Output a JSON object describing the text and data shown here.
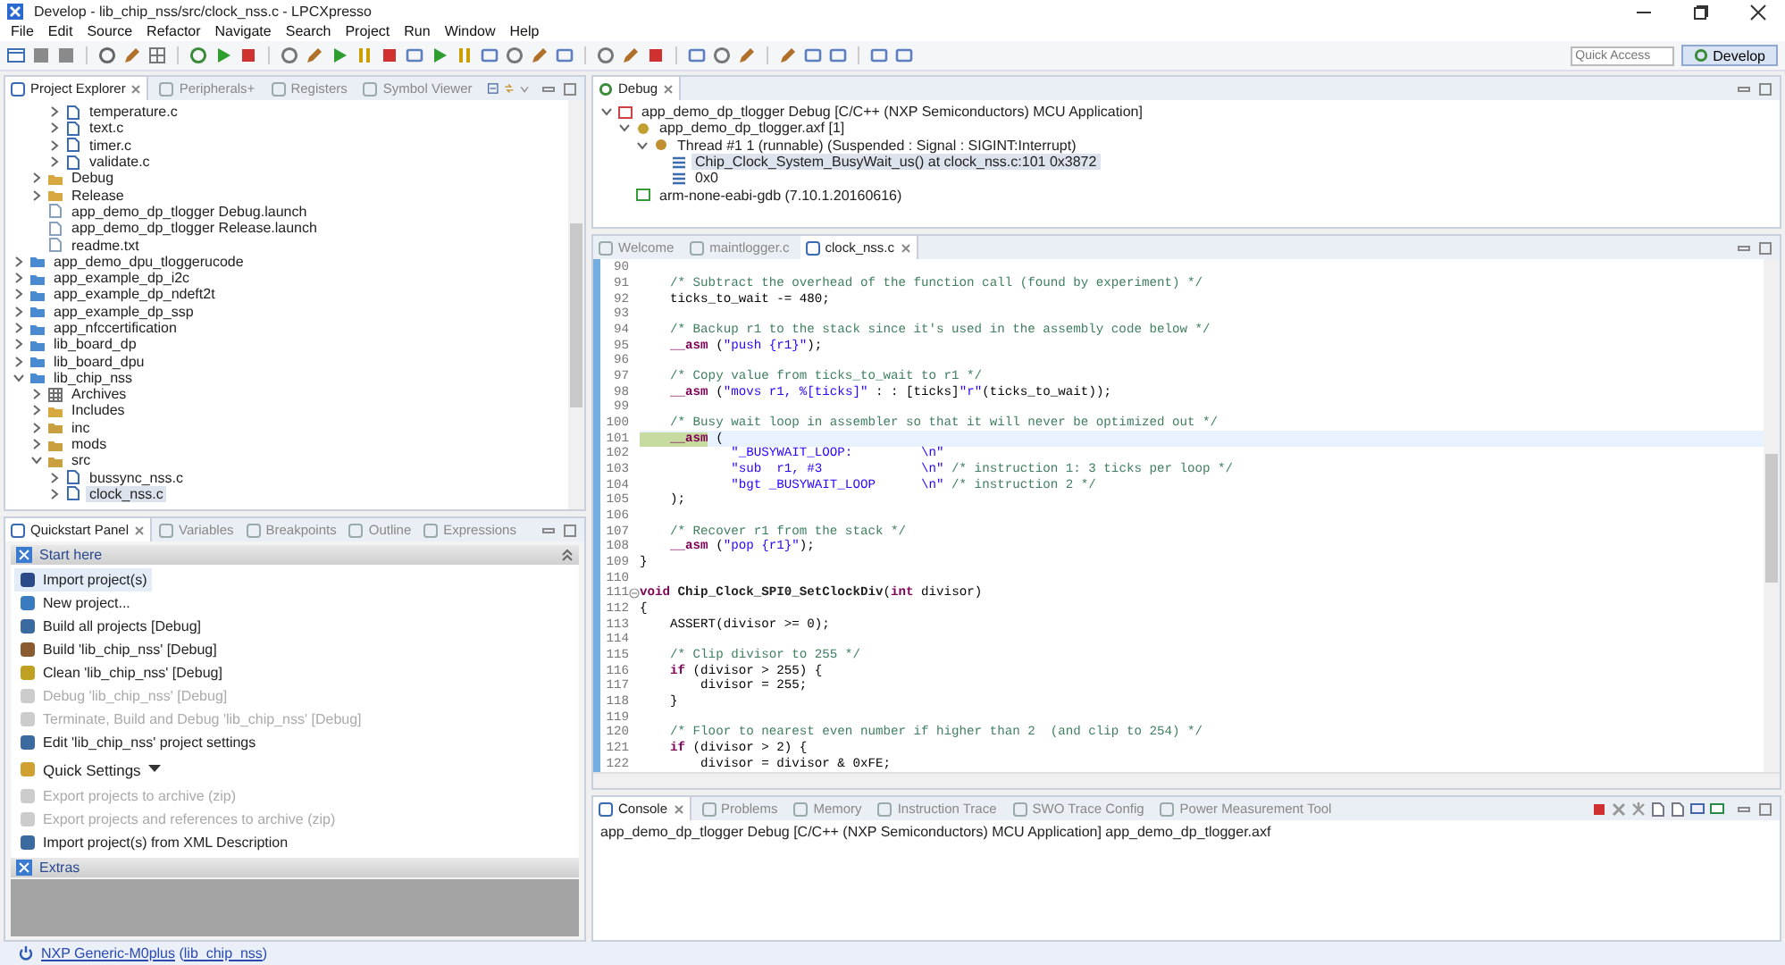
{
  "window": {
    "title": "Develop - lib_chip_nss/src/clock_nss.c - LPCXpresso"
  },
  "menu": [
    "File",
    "Edit",
    "Source",
    "Refactor",
    "Navigate",
    "Search",
    "Project",
    "Run",
    "Window",
    "Help"
  ],
  "quick_access": {
    "placeholder": "Quick Access"
  },
  "perspective": {
    "label": "Develop",
    "selected": true
  },
  "explorer": {
    "tabs": [
      {
        "label": "Project Explorer",
        "selected": true
      },
      {
        "label": "Peripherals+",
        "selected": false
      },
      {
        "label": "Registers",
        "selected": false
      },
      {
        "label": "Symbol Viewer",
        "selected": false
      }
    ],
    "tree": [
      {
        "children": [
          {
            "children": [
              {
                "label": "temperature.c",
                "kind": "c-file",
                "expanded": false,
                "selected": false
              },
              {
                "label": "text.c",
                "kind": "c-file",
                "expanded": false,
                "selected": false
              },
              {
                "label": "timer.c",
                "kind": "c-file",
                "expanded": false,
                "selected": false
              },
              {
                "label": "validate.c",
                "kind": "c-file",
                "expanded": false,
                "selected": false
              }
            ]
          },
          {
            "label": "Debug",
            "kind": "folder",
            "expanded": false,
            "selected": false
          },
          {
            "label": "Release",
            "kind": "folder",
            "expanded": false,
            "selected": false
          },
          {
            "label": "app_demo_dp_tlogger Debug.launch",
            "kind": "doc",
            "selected": false
          },
          {
            "label": "app_demo_dp_tlogger Release.launch",
            "kind": "doc",
            "selected": false
          },
          {
            "label": "readme.txt",
            "kind": "doc",
            "selected": false
          }
        ]
      },
      {
        "label": "app_demo_dpu_tloggerucode",
        "kind": "project",
        "expanded": false,
        "selected": false
      },
      {
        "label": "app_example_dp_i2c",
        "kind": "project",
        "expanded": false,
        "selected": false
      },
      {
        "label": "app_example_dp_ndeft2t",
        "kind": "project",
        "expanded": false,
        "selected": false
      },
      {
        "label": "app_example_dp_ssp",
        "kind": "project",
        "expanded": false,
        "selected": false
      },
      {
        "label": "app_nfccertification",
        "kind": "project",
        "expanded": false,
        "selected": false
      },
      {
        "label": "lib_board_dp",
        "kind": "project",
        "expanded": false,
        "selected": false
      },
      {
        "label": "lib_board_dpu",
        "kind": "project",
        "expanded": false,
        "selected": false
      },
      {
        "label": "lib_chip_nss",
        "kind": "project",
        "expanded": true,
        "selected": false,
        "children": [
          {
            "label": "Archives",
            "kind": "archive",
            "expanded": false,
            "selected": false
          },
          {
            "label": "Includes",
            "kind": "folder",
            "expanded": false,
            "selected": false
          },
          {
            "label": "inc",
            "kind": "source-folder",
            "expanded": false,
            "selected": false
          },
          {
            "label": "mods",
            "kind": "source-folder",
            "expanded": false,
            "selected": false
          },
          {
            "label": "src",
            "kind": "source-folder",
            "expanded": true,
            "selected": false,
            "children": [
              {
                "label": "bussync_nss.c",
                "kind": "c-file",
                "expanded": false,
                "selected": false
              },
              {
                "label": "clock_nss.c",
                "kind": "c-file",
                "expanded": false,
                "selected": true
              }
            ]
          }
        ]
      }
    ]
  },
  "quickstart": {
    "tabs": [
      {
        "label": "Quickstart Panel",
        "selected": true
      },
      {
        "label": "Variables",
        "selected": false
      },
      {
        "label": "Breakpoints",
        "selected": false
      },
      {
        "label": "Outline",
        "selected": false
      },
      {
        "label": "Expressions",
        "selected": false
      }
    ],
    "start_header": "Start here",
    "items": [
      {
        "label": "Import project(s)",
        "kind": "import",
        "disabled": false,
        "selected": true
      },
      {
        "label": "New project...",
        "kind": "new",
        "disabled": false,
        "selected": false
      },
      {
        "label": "Build all projects [Debug]",
        "kind": "build-all",
        "disabled": false,
        "selected": false
      },
      {
        "label": "Build 'lib_chip_nss' [Debug]",
        "kind": "build",
        "disabled": false,
        "selected": false
      },
      {
        "label": "Clean 'lib_chip_nss' [Debug]",
        "kind": "clean",
        "disabled": false,
        "selected": false
      },
      {
        "label": "Debug 'lib_chip_nss' [Debug]",
        "kind": "debug",
        "disabled": true,
        "selected": false
      },
      {
        "label": "Terminate, Build and Debug 'lib_chip_nss' [Debug]",
        "kind": "debug",
        "disabled": true,
        "selected": false
      },
      {
        "label": "Edit 'lib_chip_nss' project settings",
        "kind": "settings",
        "disabled": false,
        "selected": false
      },
      {
        "label": "Quick Settings",
        "kind": "dropdown",
        "disabled": false,
        "selected": false
      },
      {
        "label": "Export projects to archive (zip)",
        "kind": "export",
        "disabled": true,
        "selected": false
      },
      {
        "label": "Export projects and references to archive (zip)",
        "kind": "export",
        "disabled": true,
        "selected": false
      },
      {
        "label": "Import project(s) from XML Description",
        "kind": "import-xml",
        "disabled": false,
        "selected": false
      }
    ],
    "extras_header": "Extras"
  },
  "debug": {
    "tab": "Debug",
    "tree": [
      {
        "label": "app_demo_dp_tlogger Debug [C/C++ (NXP Semiconductors) MCU Application]",
        "kind": "launch",
        "expanded": true,
        "selected": false,
        "children": [
          {
            "label": "app_demo_dp_tlogger.axf [1]",
            "kind": "process",
            "expanded": true,
            "selected": false,
            "children": [
              {
                "label": "Thread #1 1 (runnable) (Suspended : Signal : SIGINT:Interrupt)",
                "kind": "thread",
                "expanded": true,
                "selected": false,
                "children": [
                  {
                    "label": "Chip_Clock_System_BusyWait_us() at clock_nss.c:101 0x3872",
                    "kind": "frame",
                    "selected": true
                  },
                  {
                    "label": "0x0",
                    "kind": "frame",
                    "selected": false
                  }
                ]
              }
            ]
          },
          {
            "label": "arm-none-eabi-gdb (7.10.1.20160616)",
            "kind": "gdb",
            "selected": false
          }
        ]
      }
    ]
  },
  "editor": {
    "tabs": [
      {
        "label": "Welcome",
        "selected": false
      },
      {
        "label": "maintlogger.c",
        "selected": false
      },
      {
        "label": "clock_nss.c",
        "selected": true
      }
    ],
    "lines": [
      {
        "num": "90",
        "current": false,
        "fold": false
      },
      {
        "num": "91",
        "current": false,
        "fold": false,
        "segments": [
          {
            "kind": "comment",
            "text": "    /* Subtract the overhead of the function call (found by experiment) */"
          }
        ]
      },
      {
        "num": "92",
        "current": false,
        "fold": false,
        "segments": [
          {
            "kind": "plain",
            "text": "    ticks_to_wait -= 480;"
          }
        ]
      },
      {
        "num": "93",
        "current": false,
        "fold": false
      },
      {
        "num": "94",
        "current": false,
        "fold": false,
        "segments": [
          {
            "kind": "comment",
            "text": "    /* Backup r1 to the stack since it's used in the assembly code below */"
          }
        ]
      },
      {
        "num": "95",
        "current": false,
        "fold": false,
        "segments": [
          {
            "kind": "keyword",
            "text": "    __asm"
          },
          {
            "kind": "plain",
            "text": " ("
          },
          {
            "kind": "string",
            "text": "\"push {r1}\""
          },
          {
            "kind": "plain",
            "text": ");"
          }
        ]
      },
      {
        "num": "96",
        "current": false,
        "fold": false
      },
      {
        "num": "97",
        "current": false,
        "fold": false,
        "segments": [
          {
            "kind": "comment",
            "text": "    /* Copy value from ticks_to_wait to r1 */"
          }
        ]
      },
      {
        "num": "98",
        "current": false,
        "fold": false,
        "segments": [
          {
            "kind": "keyword",
            "text": "    __asm"
          },
          {
            "kind": "plain",
            "text": " ("
          },
          {
            "kind": "string",
            "text": "\"movs r1, %[ticks]\""
          },
          {
            "kind": "plain",
            "text": " : : [ticks]"
          },
          {
            "kind": "string",
            "text": "\"r\""
          },
          {
            "kind": "plain",
            "text": "(ticks_to_wait));"
          }
        ]
      },
      {
        "num": "99",
        "current": false,
        "fold": false
      },
      {
        "num": "100",
        "current": false,
        "fold": false,
        "segments": [
          {
            "kind": "comment",
            "text": "    /* Busy wait loop in assembler so that it will never be optimized out */"
          }
        ]
      },
      {
        "num": "101",
        "current": true,
        "fold": false,
        "segments": [
          {
            "kind": "keyword",
            "text": "    __asm"
          },
          {
            "kind": "plain",
            "text": " ("
          }
        ]
      },
      {
        "num": "102",
        "current": false,
        "fold": false,
        "segments": [
          {
            "kind": "string",
            "text": "            \"_BUSYWAIT_LOOP:         \\n\""
          }
        ]
      },
      {
        "num": "103",
        "current": false,
        "fold": false,
        "segments": [
          {
            "kind": "string",
            "text": "            \"sub  r1, #3             \\n\""
          },
          {
            "kind": "comment",
            "text": " /* instruction 1: 3 ticks per loop */"
          }
        ]
      },
      {
        "num": "104",
        "current": false,
        "fold": false,
        "segments": [
          {
            "kind": "string",
            "text": "            \"bgt _BUSYWAIT_LOOP      \\n\""
          },
          {
            "kind": "comment",
            "text": " /* instruction 2 */"
          }
        ]
      },
      {
        "num": "105",
        "current": false,
        "fold": false,
        "segments": [
          {
            "kind": "plain",
            "text": "    );"
          }
        ]
      },
      {
        "num": "106",
        "current": false,
        "fold": false
      },
      {
        "num": "107",
        "current": false,
        "fold": false,
        "segments": [
          {
            "kind": "comment",
            "text": "    /* Recover r1 from the stack */"
          }
        ]
      },
      {
        "num": "108",
        "current": false,
        "fold": false,
        "segments": [
          {
            "kind": "keyword",
            "text": "    __asm"
          },
          {
            "kind": "plain",
            "text": " ("
          },
          {
            "kind": "string",
            "text": "\"pop {r1}\""
          },
          {
            "kind": "plain",
            "text": ");"
          }
        ]
      },
      {
        "num": "109",
        "current": false,
        "fold": false,
        "segments": [
          {
            "kind": "plain",
            "text": "}"
          }
        ]
      },
      {
        "num": "110",
        "current": false,
        "fold": false
      },
      {
        "num": "111",
        "current": false,
        "fold": true,
        "segments": [
          {
            "kind": "keyword",
            "text": "void"
          },
          {
            "kind": "function",
            "text": " Chip_Clock_SPI0_SetClockDiv"
          },
          {
            "kind": "plain",
            "text": "("
          },
          {
            "kind": "keyword",
            "text": "int"
          },
          {
            "kind": "plain",
            "text": " divisor)"
          }
        ]
      },
      {
        "num": "112",
        "current": false,
        "fold": false,
        "segments": [
          {
            "kind": "plain",
            "text": "{"
          }
        ]
      },
      {
        "num": "113",
        "current": false,
        "fold": false,
        "segments": [
          {
            "kind": "plain",
            "text": "    ASSERT(divisor >= 0);"
          }
        ]
      },
      {
        "num": "114",
        "current": false,
        "fold": false
      },
      {
        "num": "115",
        "current": false,
        "fold": false,
        "segments": [
          {
            "kind": "comment",
            "text": "    /* Clip divisor to 255 */"
          }
        ]
      },
      {
        "num": "116",
        "current": false,
        "fold": false,
        "segments": [
          {
            "kind": "keyword",
            "text": "    if"
          },
          {
            "kind": "plain",
            "text": " (divisor > 255) {"
          }
        ]
      },
      {
        "num": "117",
        "current": false,
        "fold": false,
        "segments": [
          {
            "kind": "plain",
            "text": "        divisor = 255;"
          }
        ]
      },
      {
        "num": "118",
        "current": false,
        "fold": false,
        "segments": [
          {
            "kind": "plain",
            "text": "    }"
          }
        ]
      },
      {
        "num": "119",
        "current": false,
        "fold": false
      },
      {
        "num": "120",
        "current": false,
        "fold": false,
        "segments": [
          {
            "kind": "comment",
            "text": "    /* Floor to nearest even number if higher than 2  (and clip to 254) */"
          }
        ]
      },
      {
        "num": "121",
        "current": false,
        "fold": false,
        "segments": [
          {
            "kind": "keyword",
            "text": "    if"
          },
          {
            "kind": "plain",
            "text": " (divisor > 2) {"
          }
        ]
      },
      {
        "num": "122",
        "current": false,
        "fold": false,
        "segments": [
          {
            "kind": "plain",
            "text": "        divisor = divisor & 0xFE;"
          }
        ]
      }
    ]
  },
  "console": {
    "tabs": [
      {
        "label": "Console",
        "selected": true
      },
      {
        "label": "Problems",
        "selected": false
      },
      {
        "label": "Memory",
        "selected": false
      },
      {
        "label": "Instruction Trace",
        "selected": false
      },
      {
        "label": "SWO Trace Config",
        "selected": false
      },
      {
        "label": "Power Measurement Tool",
        "selected": false
      }
    ],
    "text": "app_demo_dp_tlogger Debug [C/C++ (NXP Semiconductors) MCU Application] app_demo_dp_tlogger.axf"
  },
  "status_bar": [
    {
      "kind": "link",
      "text": "NXP Generic-M0plus"
    },
    {
      "kind": "plain",
      "text": " ("
    },
    {
      "kind": "link",
      "text": "lib_chip_nss"
    },
    {
      "kind": "plain",
      "text": ")"
    }
  ]
}
